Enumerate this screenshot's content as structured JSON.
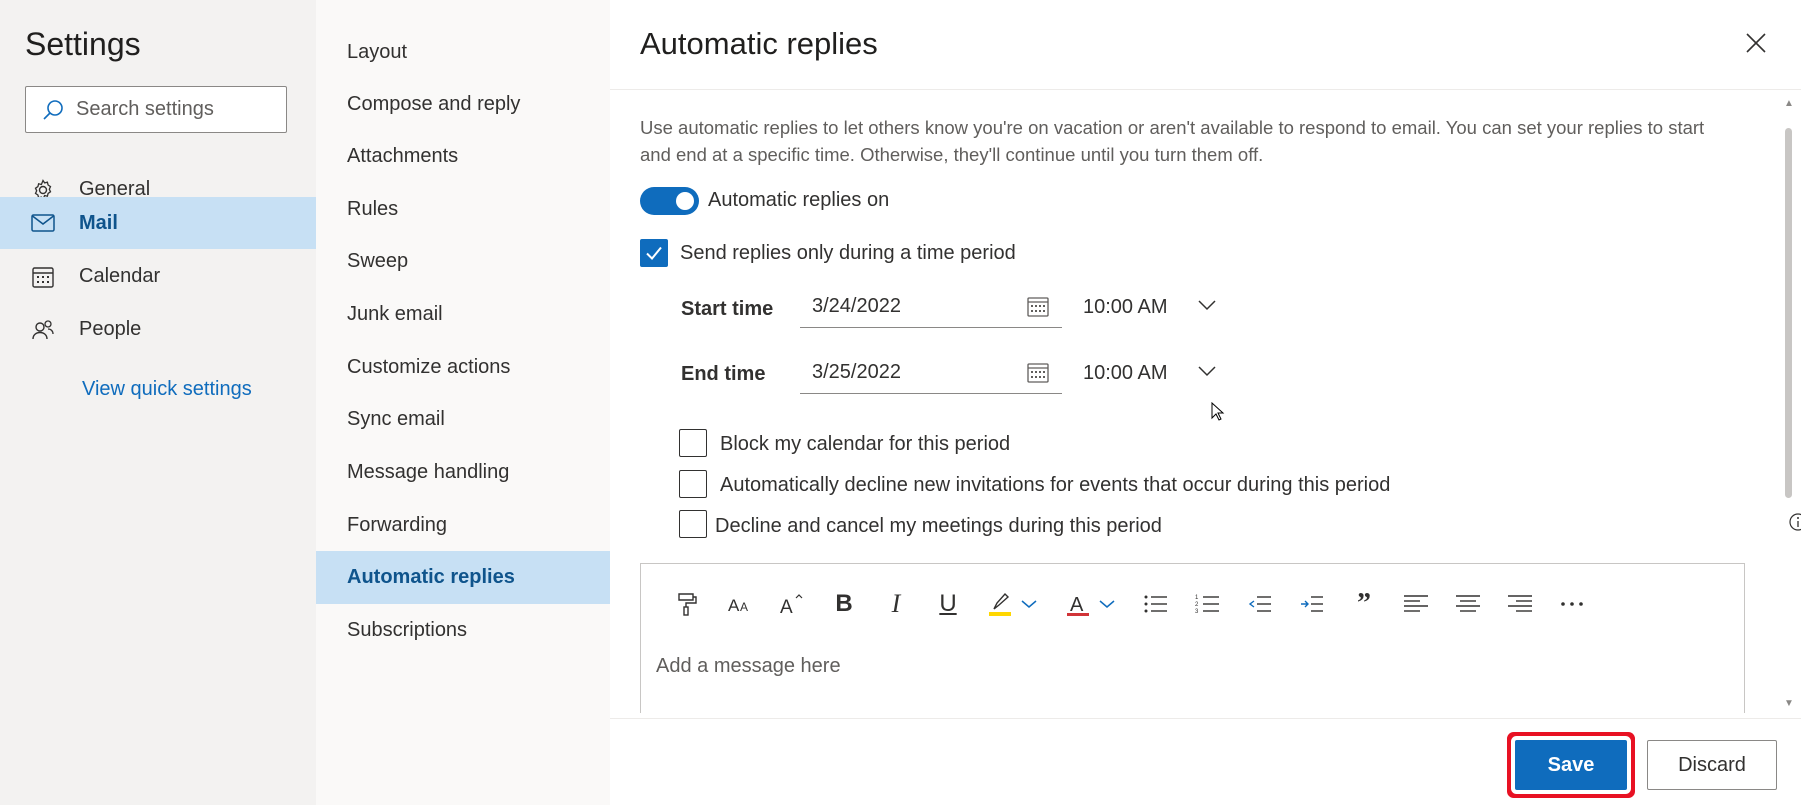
{
  "settings": {
    "title": "Settings",
    "search_placeholder": "Search settings",
    "nav": [
      {
        "label": "General",
        "icon": "gear-icon"
      },
      {
        "label": "Mail",
        "icon": "mail-icon",
        "active": true
      },
      {
        "label": "Calendar",
        "icon": "calendar-icon"
      },
      {
        "label": "People",
        "icon": "people-icon"
      }
    ],
    "quick_settings": "View quick settings"
  },
  "mail_nav": {
    "items": [
      "Layout",
      "Compose and reply",
      "Attachments",
      "Rules",
      "Sweep",
      "Junk email",
      "Customize actions",
      "Sync email",
      "Message handling",
      "Forwarding",
      "Automatic replies",
      "Subscriptions"
    ],
    "active": "Automatic replies"
  },
  "panel": {
    "title": "Automatic replies",
    "description": "Use automatic replies to let others know you're on vacation or aren't available to respond to email. You can set your replies to start and end at a specific time. Otherwise, they'll continue until you turn them off.",
    "toggle_label": "Automatic replies on",
    "toggle_on": true,
    "time_period_label": "Send replies only during a time period",
    "time_period_checked": true,
    "start": {
      "label": "Start time",
      "date": "3/24/2022",
      "time": "10:00 AM"
    },
    "end": {
      "label": "End time",
      "date": "3/25/2022",
      "time": "10:00 AM"
    },
    "options": [
      {
        "label": "Block my calendar for this period",
        "checked": false
      },
      {
        "label": "Automatically decline new invitations for events that occur during this period",
        "checked": false
      },
      {
        "label": "Decline and cancel my meetings during this period",
        "checked": false
      }
    ],
    "editor_placeholder": "Add a message here",
    "save_label": "Save",
    "discard_label": "Discard"
  },
  "colors": {
    "accent": "#0f6cbd",
    "nav_active": "#c7e0f4",
    "highlight_box": "#e81123"
  }
}
